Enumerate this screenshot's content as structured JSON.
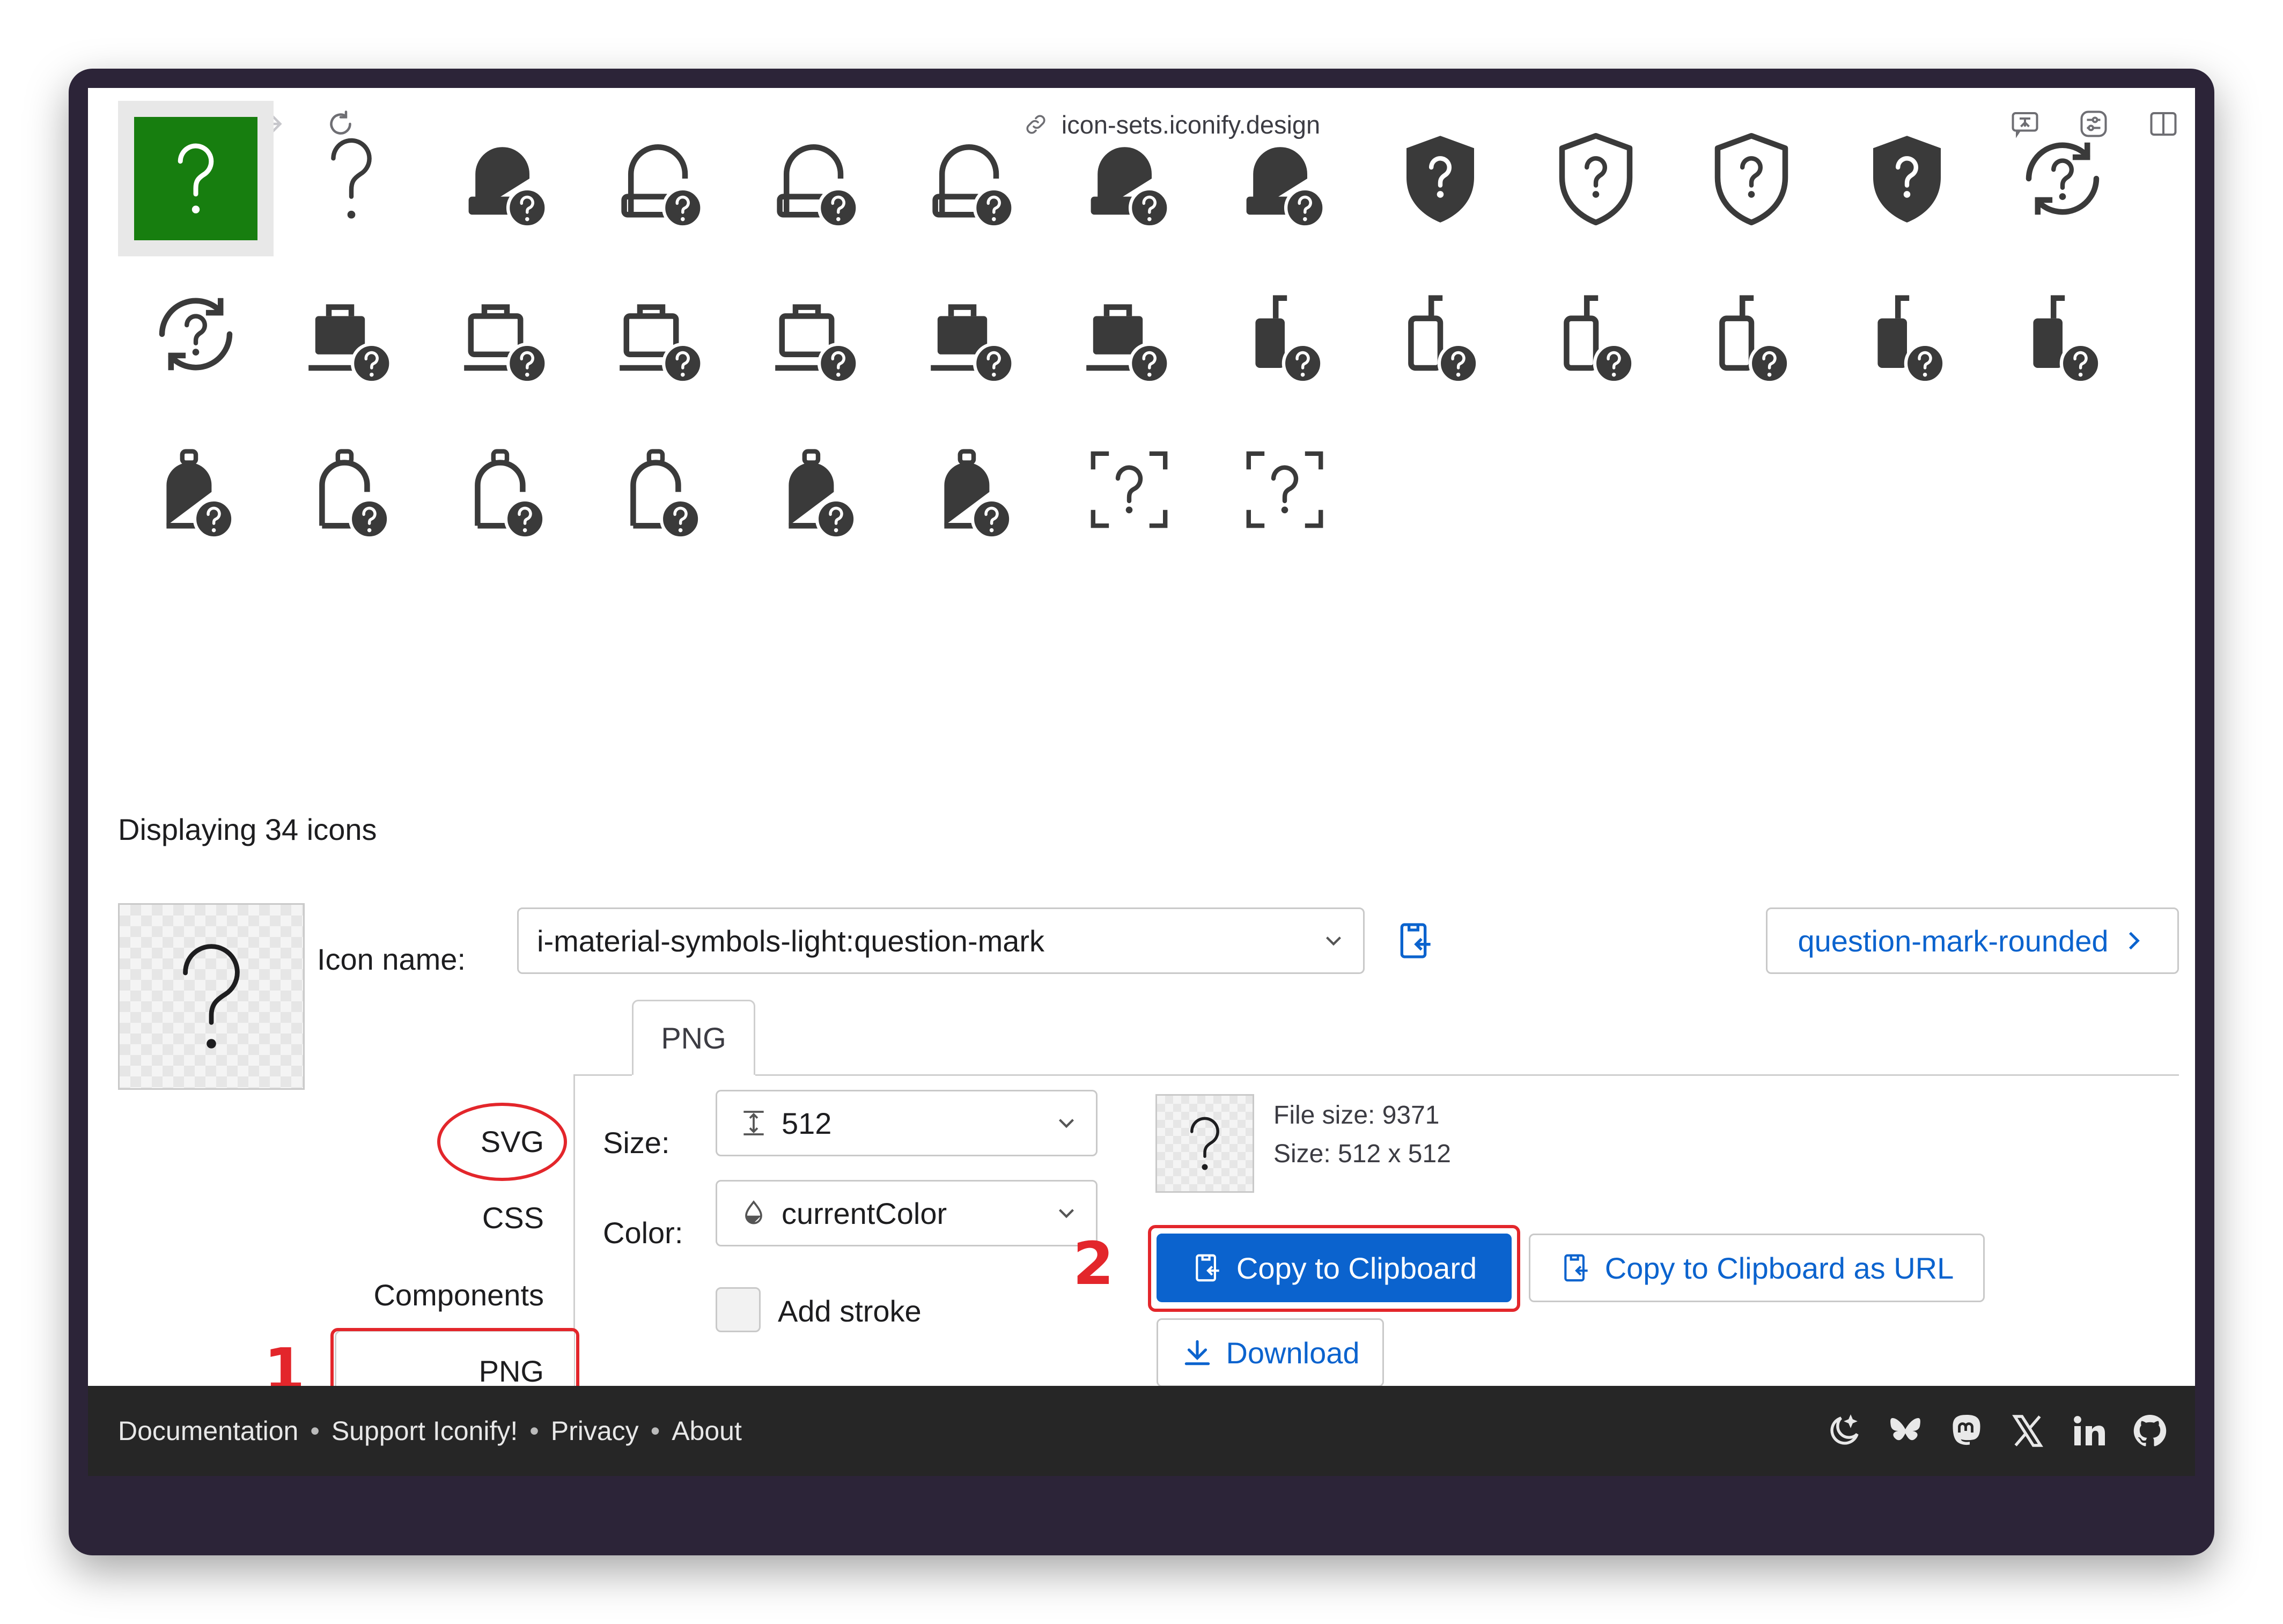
{
  "browser": {
    "url": "icon-sets.iconify.design"
  },
  "icons": {
    "rows": [
      [
        "question-mark-filled-square",
        "question-mark",
        "help-clinic-filled",
        "help-clinic-outline",
        "help-clinic-outline-2",
        "help-clinic-outline-3",
        "help-clinic-filled-2",
        "help-clinic-filled-3",
        "shield-question-filled",
        "shield-question-outline",
        "shield-question-outline-2",
        "shield-question-filled-2",
        "sync-question"
      ],
      [
        "sync-question-2",
        "work-question-filled",
        "work-question-outline",
        "work-question-outline-2",
        "work-question-outline-3",
        "work-question-filled-2",
        "work-question-filled-3",
        "luggage-question-filled",
        "luggage-question-outline",
        "luggage-question-outline-2",
        "luggage-question-outline-3",
        "luggage-question-filled-2",
        "luggage-question-filled-3"
      ],
      [
        "backpack-question-filled",
        "backpack-question-outline",
        "backpack-question-outline-2",
        "backpack-question-outline-3",
        "backpack-question-filled-2",
        "backpack-question-filled-3",
        "frame-question",
        "frame-question-2"
      ]
    ],
    "glyph": "?",
    "selected_color": "#177e0f"
  },
  "summary": "Displaying 34 icons",
  "details": {
    "icon_name_label": "Icon name:",
    "icon_name_value": "i-material-symbols-light:question-mark",
    "next_icon_label": "question-mark-rounded",
    "active_tab": "PNG",
    "side_tabs": [
      "SVG",
      "CSS",
      "Components",
      "PNG"
    ],
    "size_label": "Size:",
    "size_value": "512",
    "color_label": "Color:",
    "color_value": "currentColor",
    "add_stroke_label": "Add stroke",
    "file_size": "File size: 9371",
    "image_size": "Size: 512 x 512",
    "copy_button": "Copy to Clipboard",
    "copy_url_button": "Copy to Clipboard as URL",
    "download_button": "Download"
  },
  "annotations": {
    "step1": "1",
    "step2": "2",
    "mark_color": "#e3262b"
  },
  "footer": {
    "links": [
      "Documentation",
      "Support Iconify!",
      "Privacy",
      "About"
    ],
    "separator": "•",
    "social": [
      "moon-stars-icon",
      "bluesky-icon",
      "mastodon-icon",
      "x-icon",
      "linkedin-icon",
      "github-icon"
    ]
  },
  "colors": {
    "accent": "#0b63ce",
    "footer_bg": "#262626",
    "icon_fill": "#3a3a3a"
  }
}
